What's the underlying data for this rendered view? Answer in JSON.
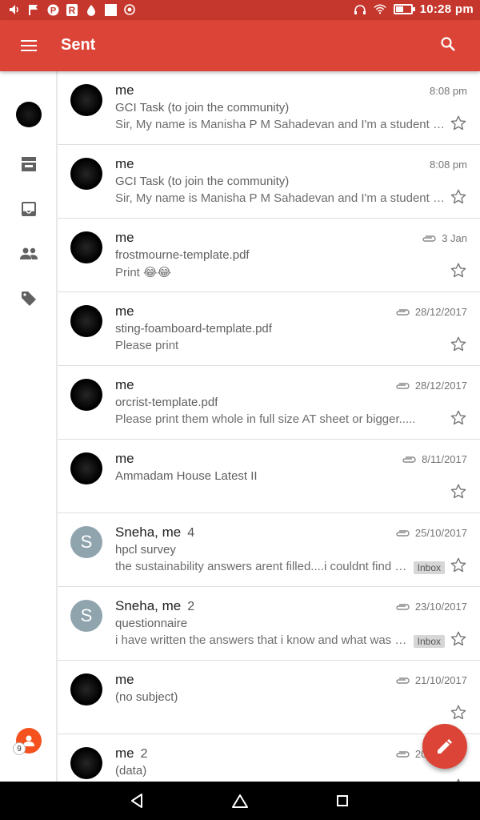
{
  "status_bar": {
    "time": "10:28 pm",
    "left_icons": [
      "volume-icon",
      "flag-icon",
      "pinterest-icon",
      "r-app-icon",
      "drop-icon",
      "square-icon",
      "record-icon"
    ],
    "battery_percent": 55
  },
  "app_bar": {
    "title": "Sent"
  },
  "rail": {
    "account_badge": "9"
  },
  "emails": [
    {
      "sender": "me",
      "count": "",
      "date": "8:08 pm",
      "attachment": false,
      "subject": "GCI Task (to join the community)",
      "snippet": "Sir, My name is Manisha P M Sahadevan and I'm a student stu...",
      "avatar": "",
      "label": ""
    },
    {
      "sender": "me",
      "count": "",
      "date": "8:08 pm",
      "attachment": false,
      "subject": "GCI Task (to join the community)",
      "snippet": "Sir, My name is Manisha P M Sahadevan and I'm a student stu...",
      "avatar": "",
      "label": ""
    },
    {
      "sender": "me",
      "count": "",
      "date": "3 Jan",
      "attachment": true,
      "subject": "frostmourne-template.pdf",
      "snippet": "Print 😂😂",
      "avatar": "",
      "label": ""
    },
    {
      "sender": "me",
      "count": "",
      "date": "28/12/2017",
      "attachment": true,
      "subject": "sting-foamboard-template.pdf",
      "snippet": "Please print",
      "avatar": "",
      "label": ""
    },
    {
      "sender": "me",
      "count": "",
      "date": "28/12/2017",
      "attachment": true,
      "subject": "orcrist-template.pdf",
      "snippet": "Please print them whole in full size AT sheet or bigger.....",
      "avatar": "",
      "label": ""
    },
    {
      "sender": "me",
      "count": "",
      "date": "8/11/2017",
      "attachment": true,
      "subject": "Ammadam House Latest II",
      "snippet": "",
      "avatar": "",
      "label": ""
    },
    {
      "sender": "Sneha, me",
      "count": "4",
      "date": "25/10/2017",
      "attachment": true,
      "subject": "hpcl survey",
      "snippet": "the sustainability answers arent filled....i couldnt find th...",
      "avatar": "S",
      "label": "Inbox"
    },
    {
      "sender": "Sneha, me",
      "count": "2",
      "date": "23/10/2017",
      "attachment": true,
      "subject": "questionnaire",
      "snippet": "i have written the answers that i know and what was th...",
      "avatar": "S",
      "label": "Inbox"
    },
    {
      "sender": "me",
      "count": "",
      "date": "21/10/2017",
      "attachment": true,
      "subject": "(no subject)",
      "snippet": "",
      "avatar": "",
      "label": ""
    },
    {
      "sender": "me",
      "count": "2",
      "date": "20/10/2017",
      "attachment": true,
      "subject": "(data)",
      "snippet": "",
      "avatar": "",
      "label": ""
    }
  ],
  "colors": {
    "brand": "#db4437",
    "status_bar": "#c5372c",
    "letter_avatar": "#90a4ae"
  }
}
